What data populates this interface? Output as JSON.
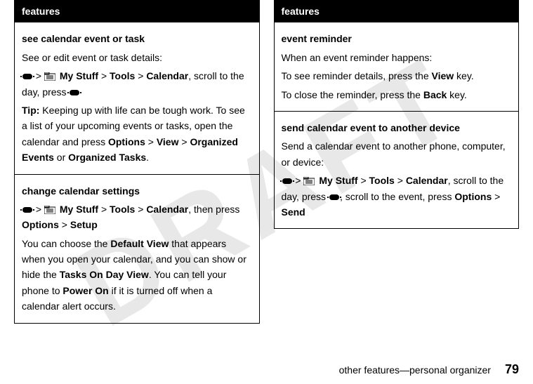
{
  "watermark": "DRAFT",
  "left": {
    "header": "features",
    "row1": {
      "title": "see calendar event or task",
      "p1": "See or edit event or task details:",
      "nav_gt": ">",
      "mystuff": "My Stuff",
      "gt2": ">",
      "tools": "Tools",
      "gt3": ">",
      "calendar": "Calendar",
      "scroll": ", scroll to the day, press ",
      "tip_label": "Tip:",
      "tip_text": " Keeping up with life can be tough work. To see a list of your upcoming events or tasks, open the calendar and press ",
      "options": "Options",
      "gt4": " > ",
      "view": "View",
      "gt5": " > ",
      "orgev": "Organized Events",
      "or": " or ",
      "orgtasks": "Organized Tasks",
      "period": "."
    },
    "row2": {
      "title": "change calendar settings",
      "nav_gt": ">",
      "mystuff": "My Stuff",
      "gt2": ">",
      "tools": "Tools",
      "gt3": ">",
      "calendar": "Calendar",
      "then": ", then press ",
      "options": "Options",
      "gt4": " > ",
      "setup": "Setup",
      "p2a": "You can choose the ",
      "defview": "Default View",
      "p2b": " that appears when you open your calendar, and you can show or hide the ",
      "tasksday": "Tasks On Day View",
      "p2c": ". You can tell your phone to ",
      "poweron": "Power On",
      "p2d": " if it is turned off when a calendar alert occurs."
    }
  },
  "right": {
    "header": "features",
    "row1": {
      "title": "event reminder",
      "p1": "When an event reminder happens:",
      "p2a": "To see reminder details, press the ",
      "viewkey": "View",
      "p2b": " key.",
      "p3a": "To close the reminder, press the ",
      "backkey": "Back",
      "p3b": " key."
    },
    "row2": {
      "title": "send calendar event to another device",
      "p1": "Send a calendar event to another phone, computer, or device:",
      "nav_gt": ">",
      "mystuff": "My Stuff",
      "gt2": ">",
      "tools": "Tools",
      "gt3": ">",
      "calendar": "Calendar",
      "scroll": ", scroll to the day, press ",
      "scroll2": ", scroll to the event, press ",
      "options": "Options",
      "gt4": " > ",
      "send": "Send"
    }
  },
  "footer": {
    "text": "other features—personal organizer",
    "page": "79"
  }
}
